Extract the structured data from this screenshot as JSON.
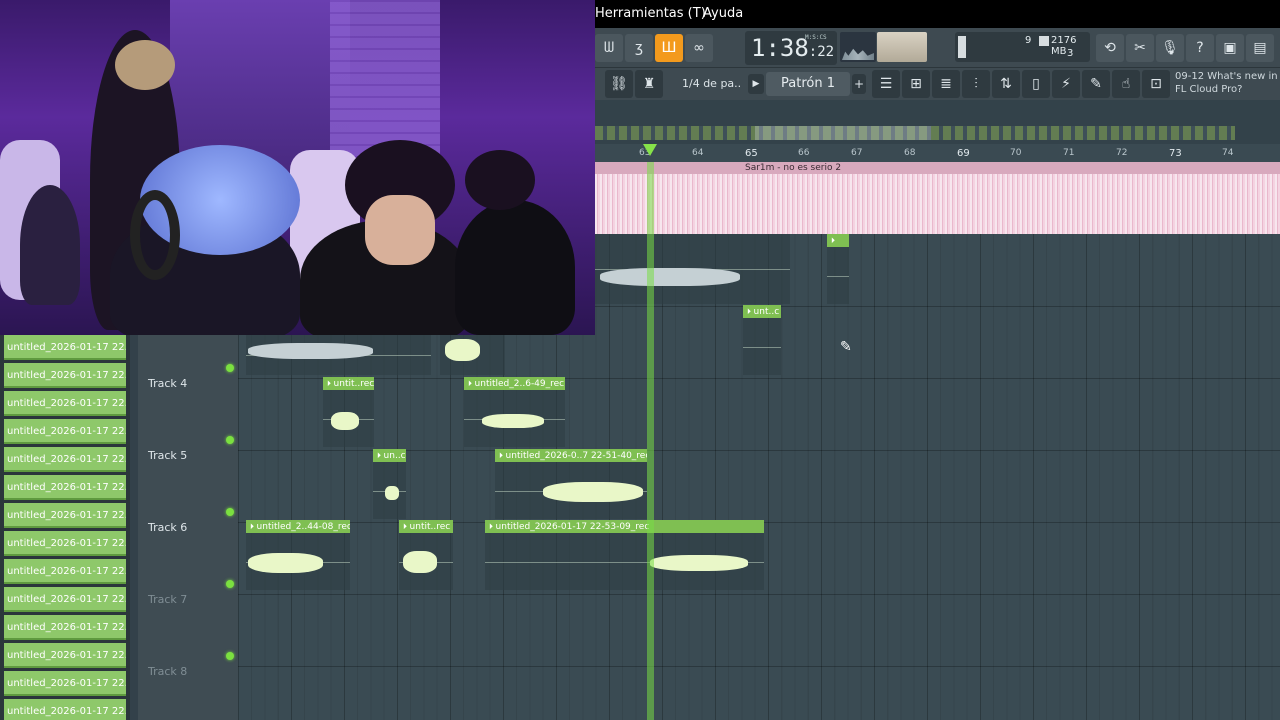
{
  "menu": {
    "tools": "Herramientas (T)",
    "help": "Ayuda"
  },
  "transport": {
    "time_main": "1:38",
    "time_sub": ":22",
    "time_unit": "M:S:CS"
  },
  "cpu": {
    "voices": "9",
    "memory": "2176 MB",
    "poly": "3"
  },
  "toolbar2": {
    "snap": "1/4 de pa..",
    "pattern": "Patrón 1",
    "pattern_add": "+"
  },
  "news": {
    "date": "09-12",
    "line1": "What's new in",
    "line2": "FL Cloud Pro?"
  },
  "ruler": {
    "bars": [
      "63",
      "64",
      "65",
      "66",
      "67",
      "68",
      "69",
      "70",
      "71",
      "72",
      "73",
      "74"
    ]
  },
  "pink_clip": {
    "label": "Sar1m - no es serio 2"
  },
  "pattern_list": {
    "item": "untitled_2026-01-17 22..."
  },
  "tracks": {
    "t4": "Track 4",
    "t5": "Track 5",
    "t6": "Track 6",
    "t7": "Track 7",
    "t8": "Track 8"
  },
  "clips": {
    "c_unt_top": "unt..c",
    "t4_a": "untit..rec",
    "t4_b": "untitled_2..6-49_rec",
    "t5_a": "un..c",
    "t5_b": "untitled_2026-0..7 22-51-40_rec",
    "t6_a": "untitled_2..44-08_rec",
    "t6_b": "untit..rec",
    "t6_c": "untitled_2026-01-17 22-53-09_rec"
  },
  "icons": [
    "wave-icon",
    "eq-icon",
    "record-wave-icon",
    "loop-icon",
    "link-icon",
    "stamp-icon",
    "pattern-icon",
    "undo-icon",
    "cut-icon",
    "mic-icon",
    "help-icon",
    "save-icon",
    "render-icon"
  ]
}
